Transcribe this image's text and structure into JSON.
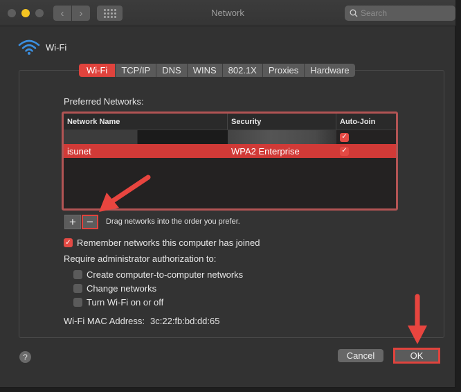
{
  "window": {
    "title": "Network",
    "search_placeholder": "Search"
  },
  "header": {
    "interface_name": "Wi-Fi",
    "icon": "wifi-icon"
  },
  "tabs": [
    {
      "label": "Wi-Fi",
      "active": true
    },
    {
      "label": "TCP/IP",
      "active": false
    },
    {
      "label": "DNS",
      "active": false
    },
    {
      "label": "WINS",
      "active": false
    },
    {
      "label": "802.1X",
      "active": false
    },
    {
      "label": "Proxies",
      "active": false
    },
    {
      "label": "Hardware",
      "active": false
    }
  ],
  "preferred_networks": {
    "label": "Preferred Networks:",
    "columns": [
      "Network Name",
      "Security",
      "Auto-Join"
    ],
    "rows": [
      {
        "name": "",
        "security": "",
        "auto_join": true,
        "redacted": true
      },
      {
        "name": "isunet",
        "security": "WPA2 Enterprise",
        "auto_join": true,
        "selected": true
      }
    ],
    "check_glyph": "✓",
    "add_label": "+",
    "remove_label": "−",
    "drag_hint": "Drag networks into the order you prefer."
  },
  "options": {
    "remember": {
      "label": "Remember networks this computer has joined",
      "checked": true
    },
    "require_admin_label": "Require administrator authorization to:",
    "admin_items": [
      {
        "label": "Create computer-to-computer networks",
        "checked": false
      },
      {
        "label": "Change networks",
        "checked": false
      },
      {
        "label": "Turn Wi-Fi on or off",
        "checked": false
      }
    ]
  },
  "mac": {
    "label": "Wi-Fi MAC Address:",
    "value": "3c:22:fb:bd:dd:65"
  },
  "footer": {
    "help_label": "?",
    "cancel_label": "Cancel",
    "ok_label": "OK"
  },
  "annotation": {
    "color": "#e8453f"
  },
  "nav": {
    "back_glyph": "‹",
    "forward_glyph": "›"
  }
}
